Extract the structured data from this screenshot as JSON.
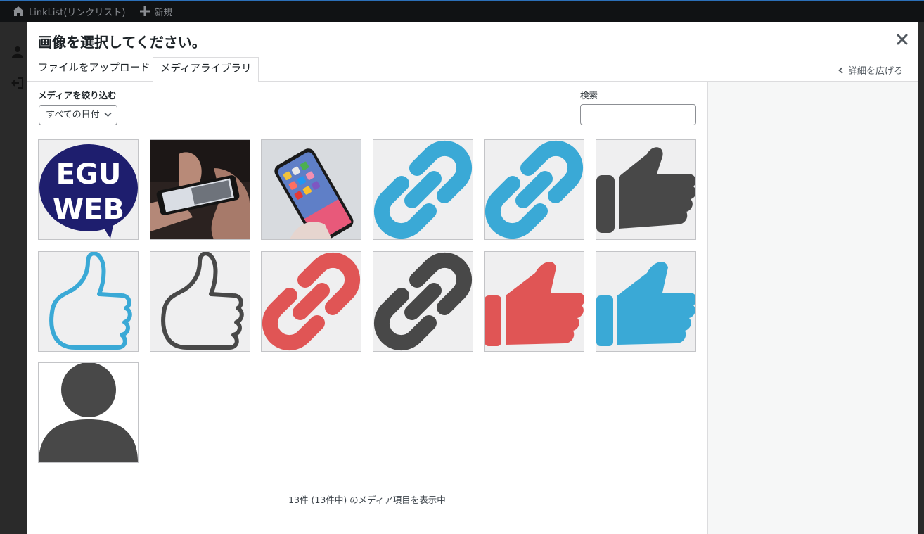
{
  "adminbar": {
    "site_title": "LinkList(リンクリスト)",
    "new_label": "新規"
  },
  "modal": {
    "title": "画像を選択してください。",
    "tabs": {
      "upload": "ファイルをアップロード",
      "library": "メディアライブラリ"
    },
    "expand_label": "詳細を広げる"
  },
  "filters": {
    "label": "メディアを絞り込む",
    "date_select": "すべての日付",
    "search_label": "検索",
    "search_value": ""
  },
  "media_items": [
    {
      "name": "egu-web-logo",
      "text": "EGU WEB"
    },
    {
      "name": "hands-phone-photo"
    },
    {
      "name": "iphone-photo"
    },
    {
      "name": "link-icon-blue-1",
      "color": "#3aa9d6"
    },
    {
      "name": "link-icon-blue-2",
      "color": "#3aa9d6"
    },
    {
      "name": "thumbs-up-dark",
      "color": "#484848"
    },
    {
      "name": "thumbs-up-outline-blue",
      "color": "#3aa9d6"
    },
    {
      "name": "thumbs-up-outline-dark",
      "color": "#484848"
    },
    {
      "name": "link-icon-red",
      "color": "#e05555"
    },
    {
      "name": "link-icon-dark",
      "color": "#484848"
    },
    {
      "name": "thumbs-up-red",
      "color": "#e05555"
    },
    {
      "name": "thumbs-up-blue",
      "color": "#3aa9d6"
    },
    {
      "name": "user-avatar-icon",
      "color": "#484848"
    }
  ],
  "status": {
    "count_text": "13件 (13件中) のメディア項目を表示中"
  }
}
